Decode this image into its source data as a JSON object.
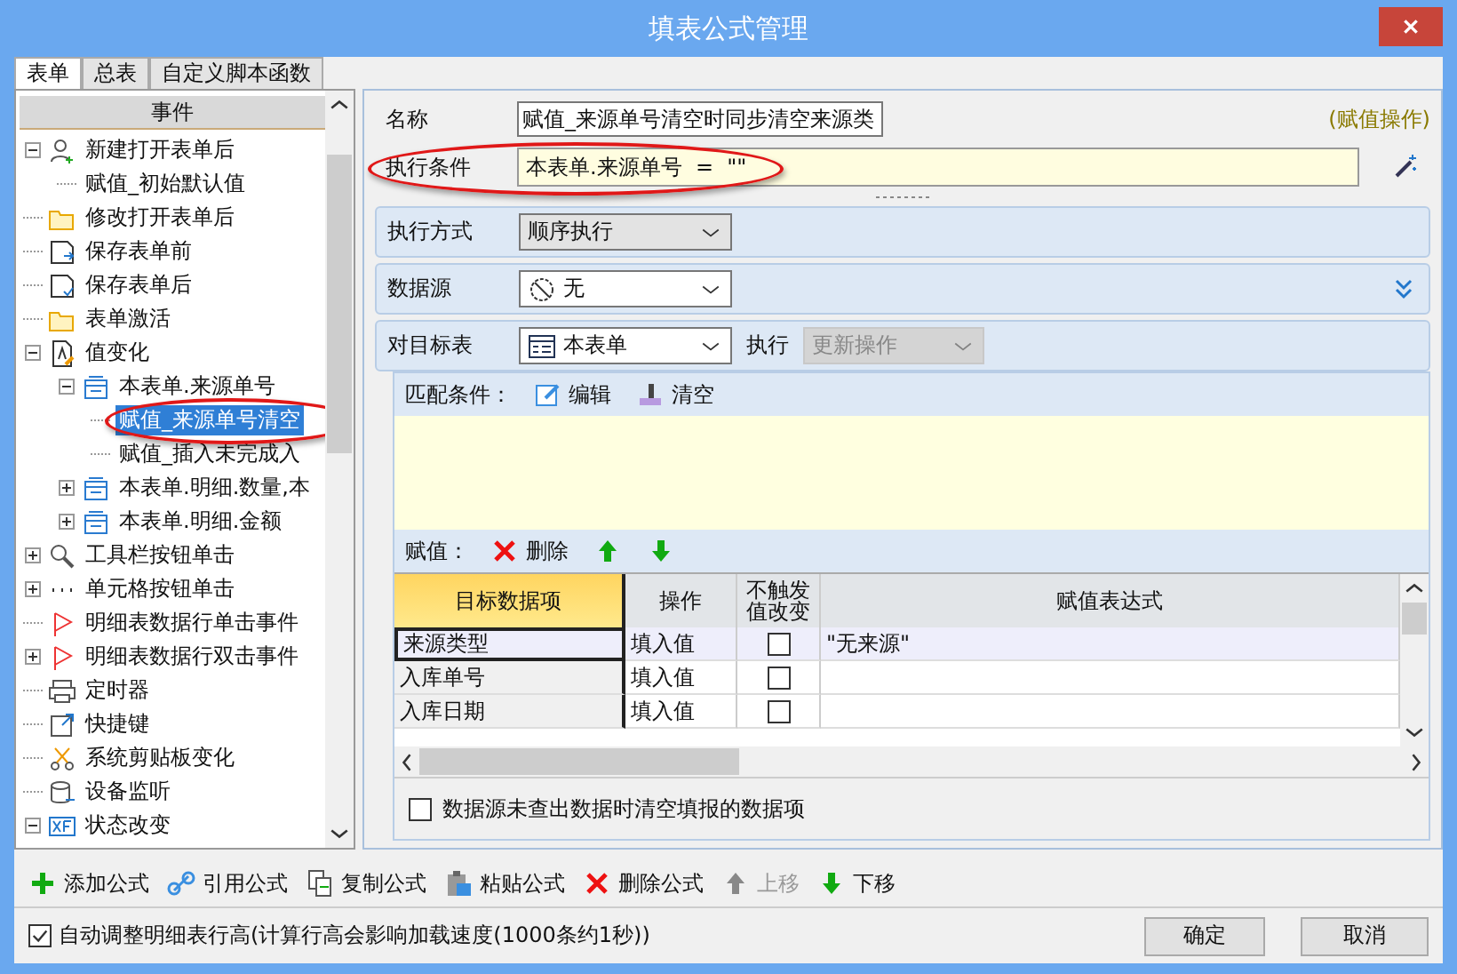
{
  "window": {
    "title": "填表公式管理"
  },
  "tabs": [
    {
      "label": "表单",
      "selected": true
    },
    {
      "label": "总表",
      "selected": false
    },
    {
      "label": "自定义脚本函数",
      "selected": false
    }
  ],
  "tree": {
    "header": "事件",
    "items": [
      {
        "label": "新建打开表单后",
        "kind": "user",
        "expanded": true,
        "children": [
          {
            "label": "赋值_初始默认值"
          }
        ]
      },
      {
        "label": "修改打开表单后",
        "kind": "folder"
      },
      {
        "label": "保存表单前",
        "kind": "save"
      },
      {
        "label": "保存表单后",
        "kind": "saved"
      },
      {
        "label": "表单激活",
        "kind": "folder"
      },
      {
        "label": "值变化",
        "kind": "doc",
        "expanded": true,
        "children": [
          {
            "label": "本表单.来源单号",
            "kind": "table",
            "expanded": true,
            "children": [
              {
                "label": "赋值_来源单号清空",
                "selected": true,
                "circled": true
              },
              {
                "label": "赋值_插入未完成入",
                "selected": false
              }
            ]
          },
          {
            "label": "本表单.明细.数量,本",
            "kind": "table",
            "expanded": false
          },
          {
            "label": "本表单.明细.金额",
            "kind": "table",
            "expanded": false
          }
        ]
      },
      {
        "label": "工具栏按钮单击",
        "kind": "tool",
        "expanded": false
      },
      {
        "label": "单元格按钮单击",
        "kind": "dots",
        "expanded": false
      },
      {
        "label": "明细表数据行单击事件",
        "kind": "flag"
      },
      {
        "label": "明细表数据行双击事件",
        "kind": "flag",
        "expanded": false
      },
      {
        "label": "定时器",
        "kind": "printer"
      },
      {
        "label": "快捷键",
        "kind": "link"
      },
      {
        "label": "系统剪贴板变化",
        "kind": "scissors"
      },
      {
        "label": "设备监听",
        "kind": "db"
      },
      {
        "label": "状态改变",
        "kind": "xf",
        "expanded": true
      }
    ]
  },
  "formula": {
    "name_label": "名称",
    "name": "赋值_来源单号清空时同步清空来源类",
    "type_hint": "(赋值操作)",
    "condition_label": "执行条件",
    "condition": "本表单.来源单号  =  \"\"",
    "condition_circled": true
  },
  "execution": {
    "label": "执行方式",
    "value": "顺序执行"
  },
  "datasource": {
    "label": "数据源",
    "value": "无"
  },
  "target": {
    "label": "对目标表",
    "value": "本表单",
    "action_label": "执行",
    "action": "更新操作",
    "action_disabled": true
  },
  "match": {
    "label": "匹配条件：",
    "buttons": [
      {
        "kind": "edit",
        "label": "编辑"
      },
      {
        "kind": "clear",
        "label": "清空"
      }
    ]
  },
  "assign": {
    "label": "赋值：",
    "buttons": [
      {
        "kind": "delete",
        "label": "删除"
      },
      {
        "kind": "up"
      },
      {
        "kind": "down"
      }
    ]
  },
  "grid": {
    "columns": [
      "目标数据项",
      "操作",
      "不触发值改变",
      "赋值表达式"
    ],
    "rows": [
      {
        "target": "来源类型",
        "op": "填入值",
        "no_trigger": false,
        "expr": "\"无来源\"",
        "selected": true
      },
      {
        "target": "入库单号",
        "op": "填入值",
        "no_trigger": false,
        "selected": false
      },
      {
        "target": "入库日期",
        "op": "填入值",
        "no_trigger": false,
        "selected": false
      }
    ]
  },
  "clear_option": {
    "label": "数据源未查出数据时清空填报的数据项",
    "checked": false
  },
  "toolbar": [
    {
      "kind": "add",
      "label": "添加公式",
      "disabled": false
    },
    {
      "kind": "link",
      "label": "引用公式",
      "disabled": false
    },
    {
      "kind": "copy",
      "label": "复制公式",
      "disabled": false
    },
    {
      "kind": "paste",
      "label": "粘贴公式",
      "disabled": false
    },
    {
      "kind": "delete",
      "label": "删除公式",
      "disabled": false
    },
    {
      "kind": "up",
      "label": "上移",
      "disabled": true
    },
    {
      "kind": "down",
      "label": "下移",
      "disabled": false
    }
  ],
  "auto_height": {
    "label": "自动调整明细表行高(计算行高会影响加载速度(1000条约1秒))",
    "checked": true
  },
  "buttons": [
    "确定",
    "取消"
  ]
}
